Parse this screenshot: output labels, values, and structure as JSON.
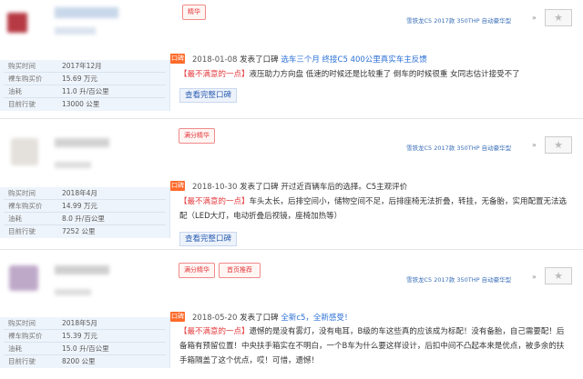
{
  "colors": {
    "accent_orange": "#ff6a2a",
    "link_blue": "#2a6fd6",
    "panel_blue": "#eef4fb",
    "tag_red": "#e4393c"
  },
  "reviews": [
    {
      "badge": "口碑",
      "date": "2018-01-08",
      "action": "发表了口碑",
      "headline": "选车三个月 终接C5 400公里真实车主反馈",
      "body_tag": "【最不满意的一点】",
      "body": "液压助力方向盘 低速的时候还是比较重了 倒车的时候很重 女同志估计接受不了",
      "read_more": "查看完整口碑",
      "model": "雪铁龙C5 2017款 350THP 自动豪华型",
      "info": [
        {
          "label": "购买时间",
          "value": "2017年12月"
        },
        {
          "label": "裸车购买价",
          "value": "15.69 万元"
        },
        {
          "label": "油耗",
          "value": "11.0 升/百公里"
        },
        {
          "label": "目前行驶",
          "value": "13000 公里"
        }
      ],
      "awards": [
        "精华"
      ]
    },
    {
      "badge": "口碑",
      "date": "2018-10-30",
      "action": "发表了口碑",
      "headline": "开过近百辆车后的选择。C5主观评价",
      "body_tag": "【最不满意的一点】",
      "body": "车头太长，后排空间小，储物空间不足，后排座椅无法折叠，转挂，无备胎，实用配置无法选配（LED大灯，电动折叠后视镜，座椅加热等）",
      "read_more": "查看完整口碑",
      "model": "雪铁龙C5 2017款 350THP 自动豪华型",
      "info": [
        {
          "label": "购买时间",
          "value": "2018年4月"
        },
        {
          "label": "裸车购买价",
          "value": "14.99 万元"
        },
        {
          "label": "油耗",
          "value": "8.0 升/百公里"
        },
        {
          "label": "目前行驶",
          "value": "7252 公里"
        }
      ],
      "awards": [
        "满分精华"
      ]
    },
    {
      "badge": "口碑",
      "date": "2018-05-20",
      "action": "发表了口碑",
      "headline": "全新c5，全新感受！",
      "body_tag": "【最不满意的一点】",
      "body": "遗憾的是没有雾灯，没有电耳，B级的车这些真的应该成为标配！没有备胎，自己需要配！后备箱有预留位置！中央扶手箱实在不明白，一个B车为什么要这样设计，后扣中间不凸起本来是优点，被多余的扶手箱隔盖了这个优点，哎！可惜，遗憾！",
      "read_more": "",
      "model": "雪铁龙C5 2017款 350THP 自动豪华型",
      "info": [
        {
          "label": "购买时间",
          "value": "2018年5月"
        },
        {
          "label": "裸车购买价",
          "value": "15.39 万元"
        },
        {
          "label": "油耗",
          "value": "15.0 升/百公里"
        },
        {
          "label": "目前行驶",
          "value": "8200 公里"
        }
      ],
      "awards": [
        "满分精华",
        "首页推荐"
      ]
    }
  ]
}
